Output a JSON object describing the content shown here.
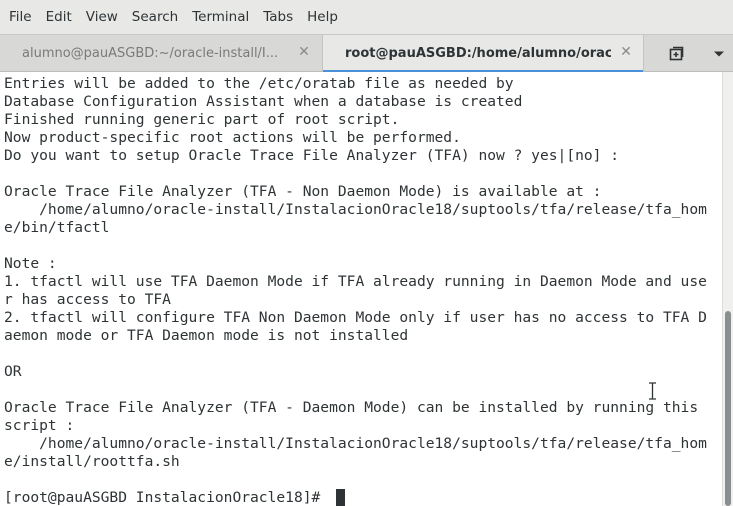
{
  "menu": {
    "items": [
      "File",
      "Edit",
      "View",
      "Search",
      "Terminal",
      "Tabs",
      "Help"
    ]
  },
  "tabs": [
    {
      "label": "alumno@pauASGBD:~/oracle-install/I...",
      "active": false,
      "close_icon": "close-icon"
    },
    {
      "label": "root@pauASGBD:/home/alumno/orac...",
      "active": true,
      "close_icon": "close-icon"
    }
  ],
  "tab_actions": {
    "new_tab_icon": "new-tab-icon",
    "tab_menu_icon": "chevron-down-icon"
  },
  "terminal": {
    "lines": [
      "Entries will be added to the /etc/oratab file as needed by",
      "Database Configuration Assistant when a database is created",
      "Finished running generic part of root script.",
      "Now product-specific root actions will be performed.",
      "Do you want to setup Oracle Trace File Analyzer (TFA) now ? yes|[no] :",
      "",
      "Oracle Trace File Analyzer (TFA - Non Daemon Mode) is available at :",
      "    /home/alumno/oracle-install/InstalacionOracle18/suptools/tfa/release/tfa_hom",
      "e/bin/tfactl",
      "",
      "Note :",
      "1. tfactl will use TFA Daemon Mode if TFA already running in Daemon Mode and use",
      "r has access to TFA",
      "2. tfactl will configure TFA Non Daemon Mode only if user has no access to TFA D",
      "aemon mode or TFA Daemon mode is not installed",
      "",
      "OR",
      "",
      "Oracle Trace File Analyzer (TFA - Daemon Mode) can be installed by running this",
      "script :",
      "    /home/alumno/oracle-install/InstalacionOracle18/suptools/tfa/release/tfa_hom",
      "e/install/roottfa.sh",
      "",
      "[root@pauASGBD InstalacionOracle18]# "
    ]
  },
  "scrollbar": {
    "position_fraction": 0.55,
    "visible_fraction": 0.45
  },
  "colors": {
    "accent": "#4a90d9",
    "text": "#2e3436",
    "background": "#ffffff"
  }
}
